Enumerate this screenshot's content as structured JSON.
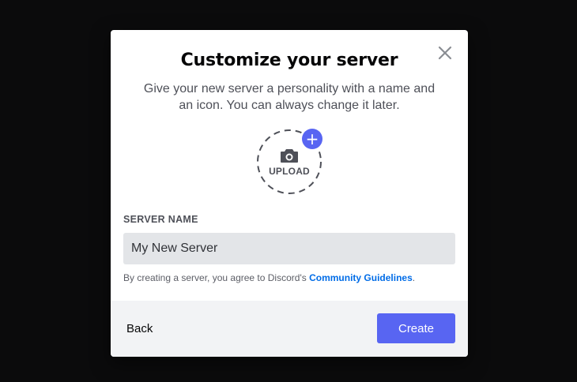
{
  "modal": {
    "title": "Customize your server",
    "subtitle": "Give your new server a personality with a name and an icon. You can always change it later.",
    "close_icon": "close-icon"
  },
  "upload": {
    "label": "UPLOAD",
    "icon": "camera-icon",
    "plus_icon": "plus-icon",
    "plus_symbol": "+"
  },
  "server_name": {
    "label": "SERVER NAME",
    "value": "My New Server"
  },
  "agreement": {
    "text": "By creating a server, you agree to Discord's ",
    "link": "Community Guidelines",
    "end": "."
  },
  "footer": {
    "back_label": "Back",
    "create_label": "Create"
  },
  "colors": {
    "accent": "#5865f2",
    "link": "#006ce7",
    "input_bg": "#e3e5e8",
    "footer_bg": "#f2f3f5"
  }
}
